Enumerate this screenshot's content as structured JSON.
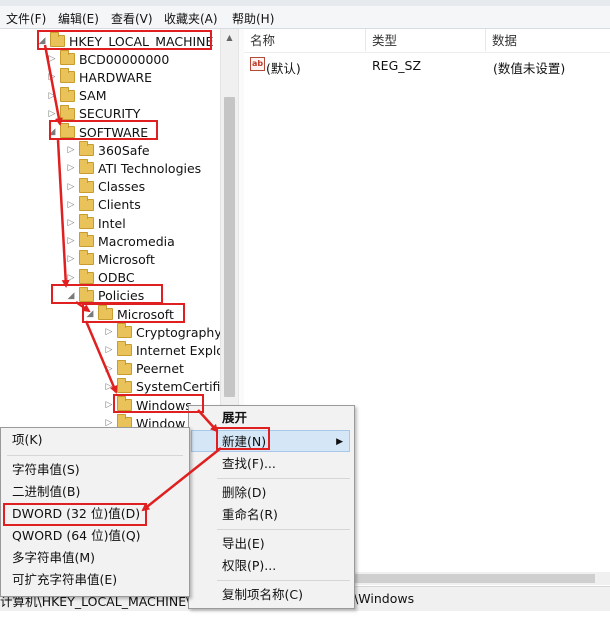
{
  "menubar": {
    "items": [
      {
        "id": "file",
        "label": "文件(F)"
      },
      {
        "id": "edit",
        "label": "编辑(E)"
      },
      {
        "id": "view",
        "label": "查看(V)"
      },
      {
        "id": "favorites",
        "label": "收藏夹(A)"
      },
      {
        "id": "help",
        "label": "帮助(H)"
      }
    ]
  },
  "tree": {
    "nodes": [
      {
        "label": "HKEY_LOCAL_MACHINE",
        "expanded": true
      },
      {
        "label": "BCD00000000",
        "expanded": false
      },
      {
        "label": "HARDWARE",
        "expanded": false
      },
      {
        "label": "SAM",
        "expanded": false
      },
      {
        "label": "SECURITY",
        "expanded": false
      },
      {
        "label": "SOFTWARE",
        "expanded": true
      },
      {
        "label": "360Safe",
        "expanded": false
      },
      {
        "label": "ATI Technologies",
        "expanded": false
      },
      {
        "label": "Classes",
        "expanded": false
      },
      {
        "label": "Clients",
        "expanded": false
      },
      {
        "label": "Intel",
        "expanded": false
      },
      {
        "label": "Macromedia",
        "expanded": false
      },
      {
        "label": "Microsoft",
        "expanded": false
      },
      {
        "label": "ODBC",
        "expanded": false
      },
      {
        "label": "Policies",
        "expanded": true
      },
      {
        "label": "Microsoft",
        "expanded": true
      },
      {
        "label": "Cryptography",
        "expanded": false
      },
      {
        "label": "Internet Explo",
        "expanded": false
      },
      {
        "label": "Peernet",
        "expanded": false
      },
      {
        "label": "SystemCertific",
        "expanded": false
      },
      {
        "label": "Windows",
        "expanded": false,
        "selected": true
      },
      {
        "label": "Window",
        "expanded": false
      }
    ]
  },
  "list": {
    "columns": [
      "名称",
      "类型",
      "数据"
    ],
    "rows": [
      {
        "name": "(默认)",
        "type": "REG_SZ",
        "data": "(数值未设置)",
        "icon": "string-value-icon"
      }
    ]
  },
  "status": {
    "left_text": "计算机\\HKEY_LOCAL_MACHINE\\",
    "right_text": "ft\\Windows"
  },
  "context_menu": {
    "items": {
      "expand": "展开",
      "new": "新建(N)",
      "find": "查找(F)...",
      "delete": "删除(D)",
      "rename": "重命名(R)",
      "export": "导出(E)",
      "permissions": "权限(P)...",
      "copy_key_name": "复制项名称(C)"
    }
  },
  "new_submenu": {
    "items": {
      "key": "项(K)",
      "string": "字符串值(S)",
      "binary": "二进制值(B)",
      "dword": "DWORD (32 位)值(D)",
      "qword": "QWORD (64 位)值(Q)",
      "multi_string": "多字符串值(M)",
      "expandable_string": "可扩充字符串值(E)"
    }
  },
  "colors": {
    "annotation_red": "#e02020",
    "menu_highlight": "#d5e6f7",
    "folder": "#e9c25a"
  }
}
